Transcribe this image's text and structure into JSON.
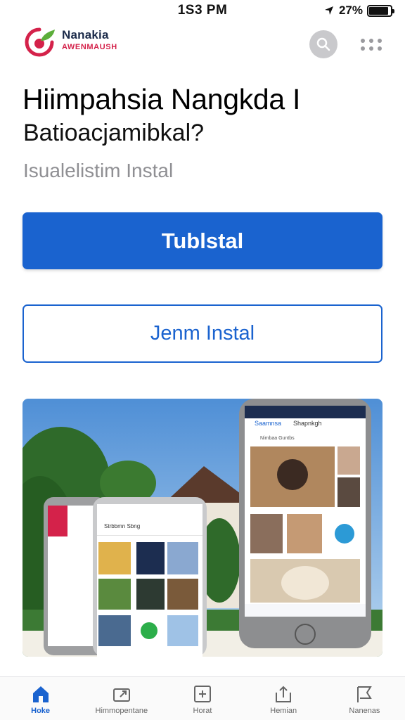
{
  "status_bar": {
    "time": "1S3 PM",
    "battery": "27%",
    "battery_level": 0.9
  },
  "header": {
    "brand_name": "Nanakia",
    "brand_sub": "AWENMAUSH"
  },
  "headline": "Hiimpahsia Nangkda I",
  "subheadline": "Batioacjamibkal?",
  "caption": "Isualelistim Instal",
  "buttons": {
    "primary": "Tublstal",
    "secondary": "Jenm Instal"
  },
  "hero": {
    "front_phone_header": "Strbbmn Sbng",
    "back_phone_header_left": "Saamnsa",
    "back_phone_header_right": "Shapnkgh",
    "back_phone_subheader": "Nimbaa Guntbs"
  },
  "nav": [
    {
      "label": "Hoke",
      "icon": "home-icon",
      "active": true
    },
    {
      "label": "Himmopentane",
      "icon": "share-icon",
      "active": false
    },
    {
      "label": "Horat",
      "icon": "add-box-icon",
      "active": false
    },
    {
      "label": "Hemian",
      "icon": "upload-icon",
      "active": false
    },
    {
      "label": "Nanenas",
      "icon": "flag-icon",
      "active": false
    }
  ],
  "colors": {
    "accent": "#1a63cf",
    "brand_red": "#d4224a",
    "brand_green": "#5cae3a"
  }
}
